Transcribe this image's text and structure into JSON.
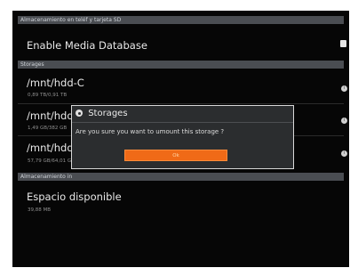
{
  "header": {
    "section_title": "Almacenamiento en teléf y tarjeta SD"
  },
  "media": {
    "label": "Enable Media Database",
    "checked": true
  },
  "storages": {
    "section_label": "Storages",
    "items": [
      {
        "path": "/mnt/hdd-C",
        "size": "0,89 TB/0,91 TB"
      },
      {
        "path": "/mnt/hdd-D",
        "size": "1,49 GB/382 GB"
      },
      {
        "path": "/mnt/hdd-E",
        "size": "57,79 GB/64,01 GB"
      }
    ]
  },
  "internal": {
    "section_label": "Almacenamiento in",
    "free_label": "Espacio disponible",
    "free_value": "39,88 MB"
  },
  "dialog": {
    "title": "Storages",
    "message": "Are you sure you want to umount this storage ?",
    "ok_label": "Ok",
    "accent_color": "#f06a17"
  }
}
